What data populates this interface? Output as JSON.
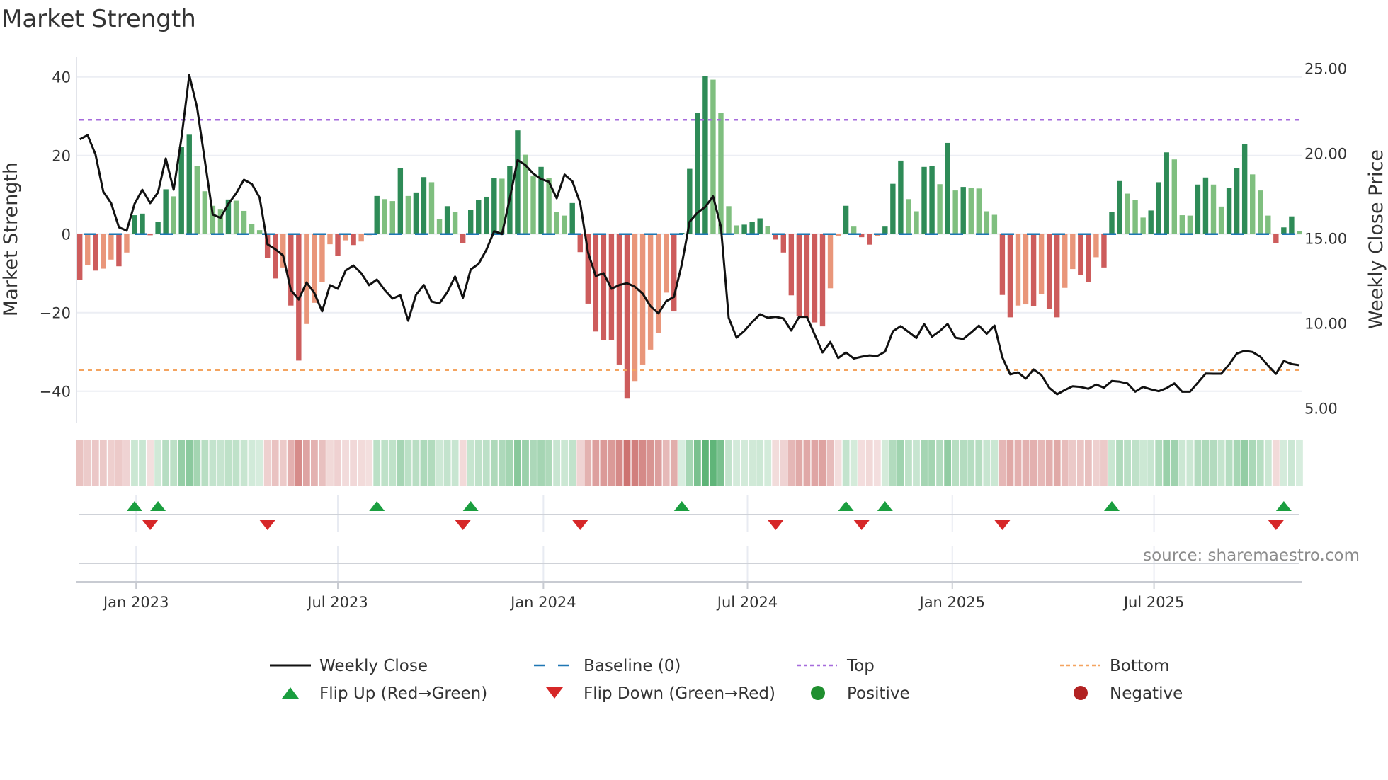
{
  "chart_data": {
    "type": "bar",
    "title": "Market Strength",
    "ylabel_left": "Market Strength",
    "ylabel_right": "Weekly Close Price",
    "xlabel": "",
    "x_unit": "week index",
    "ylim_left": [
      -48,
      45
    ],
    "ylim_right": [
      4.1,
      25.7
    ],
    "yticks_left": [
      40,
      20,
      0,
      -20,
      -40
    ],
    "yticks_left_labels": [
      "40",
      "20",
      "0",
      "−20",
      "−40"
    ],
    "yticks_right": [
      25,
      20,
      15,
      10,
      5
    ],
    "yticks_right_labels": [
      "25.00",
      "20.00",
      "15.00",
      "10.00",
      "5.00"
    ],
    "xticks": [
      {
        "label": "Jan 2023",
        "week": 7.2
      },
      {
        "label": "Jul 2023",
        "week": 33.0
      },
      {
        "label": "Jan 2024",
        "week": 59.3
      },
      {
        "label": "Jul 2024",
        "week": 85.4
      },
      {
        "label": "Jan 2025",
        "week": 111.6
      },
      {
        "label": "Jul 2025",
        "week": 137.4
      }
    ],
    "top_level": 29.1,
    "bottom_level": -34.6,
    "baseline": 0,
    "strength": [
      -11.6,
      -7.8,
      -9.3,
      -8.8,
      -6.5,
      -8.2,
      -4.7,
      4.8,
      5.2,
      -0.3,
      3.1,
      11.4,
      9.6,
      22.2,
      25.3,
      17.4,
      10.9,
      7.2,
      6.4,
      8.8,
      8.5,
      5.9,
      2.6,
      1.0,
      -6.1,
      -11.3,
      -8.5,
      -18.2,
      -32.2,
      -22.9,
      -17.5,
      -12.3,
      -2.6,
      -5.5,
      -1.6,
      -2.8,
      -1.9,
      -0.3,
      9.7,
      8.9,
      8.4,
      16.8,
      9.7,
      10.6,
      14.5,
      13.2,
      3.9,
      7.1,
      5.7,
      -2.3,
      6.2,
      8.7,
      9.5,
      14.2,
      14.1,
      17.4,
      26.4,
      20.2,
      14.7,
      17.1,
      14.2,
      5.7,
      4.7,
      7.9,
      -4.6,
      -17.7,
      -24.8,
      -26.9,
      -27.0,
      -33.2,
      -41.9,
      -37.4,
      -33.2,
      -29.4,
      -25.2,
      -14.9,
      -19.7,
      0.3,
      16.6,
      30.9,
      40.2,
      39.3,
      30.8,
      7.1,
      2.2,
      2.4,
      3.1,
      4.0,
      2.1,
      -1.4,
      -4.7,
      -15.6,
      -20.8,
      -21.3,
      -22.5,
      -23.5,
      -13.8,
      -0.6,
      7.2,
      1.9,
      -0.8,
      -2.7,
      -0.5,
      1.9,
      12.8,
      18.7,
      8.9,
      5.8,
      17.1,
      17.4,
      12.7,
      23.2,
      11.1,
      12.0,
      11.8,
      11.6,
      5.8,
      4.9,
      -15.5,
      -21.2,
      -18.2,
      -17.9,
      -18.4,
      -15.2,
      -19.1,
      -21.2,
      -13.7,
      -8.9,
      -10.4,
      -12.3,
      -5.9,
      -8.5,
      5.6,
      13.5,
      10.3,
      8.7,
      4.2,
      6.0,
      13.2,
      20.8,
      19.0,
      4.8,
      4.7,
      12.6,
      14.4,
      12.6,
      7.0,
      11.8,
      16.7,
      22.9,
      15.2,
      11.1,
      4.7,
      -2.3,
      1.7,
      4.5,
      0.7
    ],
    "weekly_close": [
      20.83,
      21.07,
      19.95,
      17.75,
      17.07,
      15.65,
      15.45,
      17.03,
      17.86,
      17.07,
      17.7,
      19.7,
      17.86,
      20.9,
      24.61,
      22.7,
      19.57,
      16.4,
      16.2,
      17.03,
      17.65,
      18.45,
      18.2,
      17.4,
      14.65,
      14.36,
      13.99,
      11.95,
      11.4,
      12.4,
      11.78,
      10.7,
      12.24,
      12.03,
      13.11,
      13.4,
      12.95,
      12.24,
      12.57,
      11.95,
      11.45,
      11.65,
      10.15,
      11.67,
      12.25,
      11.28,
      11.17,
      11.82,
      12.75,
      11.5,
      13.17,
      13.49,
      14.32,
      15.42,
      15.25,
      17.36,
      19.61,
      19.31,
      18.81,
      18.49,
      18.33,
      17.36,
      18.75,
      18.36,
      17.08,
      14.17,
      12.78,
      12.95,
      12.03,
      12.25,
      12.36,
      12.15,
      11.74,
      11.0,
      10.58,
      11.3,
      11.55,
      13.47,
      15.97,
      16.51,
      16.85,
      17.47,
      15.68,
      10.32,
      9.15,
      9.55,
      10.07,
      10.53,
      10.32,
      10.38,
      10.28,
      9.57,
      10.38,
      10.38,
      9.32,
      8.28,
      8.9,
      7.95,
      8.28,
      7.92,
      8.03,
      8.11,
      8.07,
      8.33,
      9.53,
      9.83,
      9.49,
      9.13,
      9.95,
      9.21,
      9.54,
      9.96,
      9.15,
      9.07,
      9.45,
      9.86,
      9.38,
      9.86,
      7.99,
      6.99,
      7.11,
      6.74,
      7.28,
      6.95,
      6.2,
      5.82,
      6.07,
      6.29,
      6.25,
      6.14,
      6.39,
      6.21,
      6.6,
      6.56,
      6.46,
      5.97,
      6.25,
      6.11,
      6.0,
      6.18,
      6.46,
      5.97,
      5.97,
      6.5,
      7.04,
      7.03,
      7.03,
      7.57,
      8.22,
      8.38,
      8.31,
      8.03,
      7.5,
      7.02,
      7.78,
      7.6,
      7.53
    ],
    "legend": {
      "placement": "bottom",
      "entries": [
        {
          "label": "Weekly Close",
          "kind": "line"
        },
        {
          "label": "Baseline (0)",
          "kind": "dashed"
        },
        {
          "label": "Top",
          "kind": "dotted"
        },
        {
          "label": "Bottom",
          "kind": "dotted"
        },
        {
          "label": "Flip Up (Red→Green)",
          "kind": "triangle-up"
        },
        {
          "label": "Flip Down (Green→Red)",
          "kind": "triangle-down"
        },
        {
          "label": "Positive",
          "kind": "circle"
        },
        {
          "label": "Negative",
          "kind": "circle"
        }
      ]
    },
    "annotation": "source: sharemaestro.com",
    "colors": {
      "pos_rising": "#2e8b57",
      "pos_falling": "#7fbf7f",
      "neg_falling": "#cd5c5c",
      "neg_rising": "#e9967a",
      "close_line": "#111111",
      "baseline": "#1f77b4",
      "top": "#a66bdc",
      "bottom": "#f4a460",
      "flip_up": "#1a9e3f",
      "flip_down": "#d62728",
      "positive": "#1f8f2f",
      "negative": "#b22222",
      "strip_pos": "#2e9e4f",
      "strip_neg": "#c0504d"
    }
  }
}
